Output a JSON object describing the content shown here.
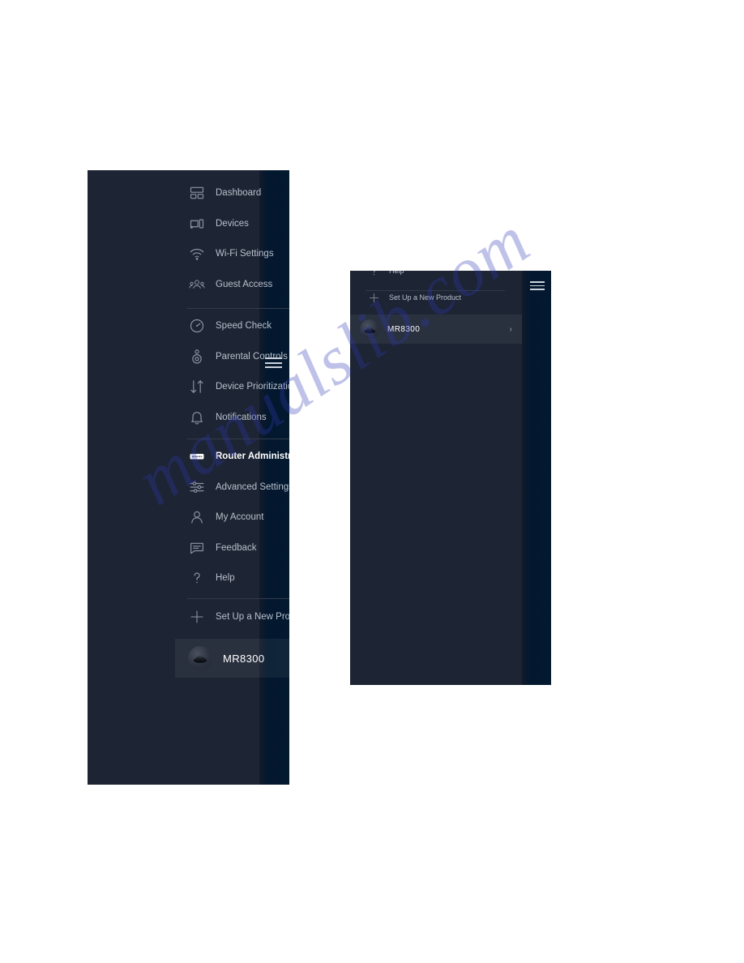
{
  "page": {
    "watermark": "manualslib.com",
    "background": "#ffffff"
  },
  "colors": {
    "sidebar_background": "#1d2433",
    "edge_strip": "#03182e",
    "label": "#b9c0cc",
    "active_label": "#ffffff",
    "divider": "#333b4b",
    "active_row_background": "rgba(255,255,255,0.055)",
    "watermark": "#2e3ab5"
  },
  "sidebar": {
    "menu_toggle": "hamburger-menu-icon",
    "groups": [
      {
        "items": [
          {
            "icon": "dashboard-icon",
            "label": "Dashboard",
            "active": false
          },
          {
            "icon": "devices-icon",
            "label": "Devices",
            "active": false
          },
          {
            "icon": "wifi-icon",
            "label": "Wi-Fi Settings",
            "active": false
          },
          {
            "icon": "guest-access-icon",
            "label": "Guest Access",
            "active": false
          }
        ]
      },
      {
        "items": [
          {
            "icon": "speed-check-icon",
            "label": "Speed Check",
            "active": false
          },
          {
            "icon": "parental-controls-icon",
            "label": "Parental Controls",
            "active": false
          },
          {
            "icon": "device-prioritization-icon",
            "label": "Device Prioritization",
            "active": false
          },
          {
            "icon": "notifications-bell-icon",
            "label": "Notifications",
            "active": false
          }
        ]
      },
      {
        "items": [
          {
            "icon": "router-administration-icon",
            "label": "Router Administration",
            "active": true
          },
          {
            "icon": "advanced-settings-icon",
            "label": "Advanced Settings",
            "active": false
          },
          {
            "icon": "my-account-icon",
            "label": "My Account",
            "active": false
          },
          {
            "icon": "feedback-icon",
            "label": "Feedback",
            "active": false
          },
          {
            "icon": "help-icon",
            "label": "Help",
            "active": false
          }
        ]
      },
      {
        "items": [
          {
            "icon": "plus-icon",
            "label": "Set Up a New Product",
            "active": false
          }
        ]
      }
    ],
    "device": {
      "icon": "router-thumbnail-icon",
      "name": "MR8300",
      "chevron": "›"
    }
  }
}
